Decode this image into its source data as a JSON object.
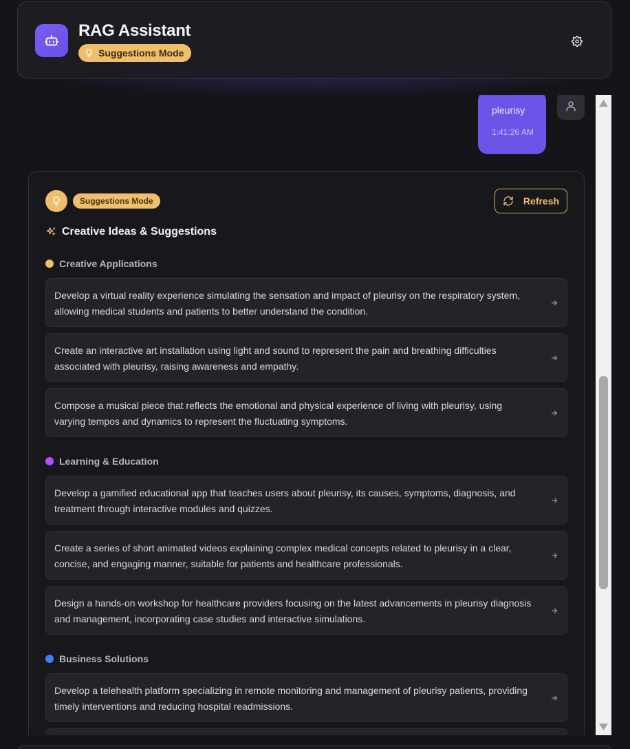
{
  "header": {
    "title": "RAG Assistant",
    "mode_label": "Suggestions Mode",
    "settings_icon": "gear-icon",
    "bot_icon": "bot-icon"
  },
  "message": {
    "text": "pleurisy",
    "time": "1:41:26 AM",
    "avatar_icon": "user-icon"
  },
  "card": {
    "mode_label": "Suggestions Mode",
    "refresh_label": "Refresh",
    "heading": "Creative Ideas & Suggestions",
    "categories": [
      {
        "label": "Creative Applications",
        "color": "#f0bf6c",
        "items": [
          "Develop a virtual reality experience simulating the sensation and impact of pleurisy on the respiratory system, allowing medical students and patients to better understand the condition.",
          "Create an interactive art installation using light and sound to represent the pain and breathing difficulties associated with pleurisy, raising awareness and empathy.",
          "Compose a musical piece that reflects the emotional and physical experience of living with pleurisy, using varying tempos and dynamics to represent the fluctuating symptoms."
        ]
      },
      {
        "label": "Learning & Education",
        "color": "#a855f7",
        "items": [
          "Develop a gamified educational app that teaches users about pleurisy, its causes, symptoms, diagnosis, and treatment through interactive modules and quizzes.",
          "Create a series of short animated videos explaining complex medical concepts related to pleurisy in a clear, concise, and engaging manner, suitable for patients and healthcare professionals.",
          "Design a hands-on workshop for healthcare providers focusing on the latest advancements in pleurisy diagnosis and management, incorporating case studies and interactive simulations."
        ]
      },
      {
        "label": "Business Solutions",
        "color": "#3b82f6",
        "items": [
          "Develop a telehealth platform specializing in remote monitoring and management of pleurisy patients, providing timely interventions and reducing hospital readmissions."
        ]
      }
    ]
  },
  "colors": {
    "accent": "#6c54e8",
    "suggestion": "#f0bf6c",
    "background": "#141419"
  }
}
